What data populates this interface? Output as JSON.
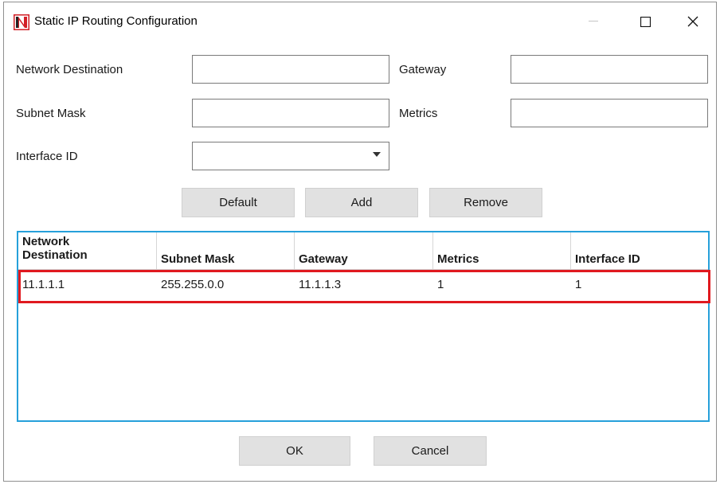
{
  "window": {
    "title": "Static IP Routing Configuration",
    "app_icon": "n-logo-icon",
    "controls": {
      "minimize": "minimize-icon",
      "maximize": "maximize-icon",
      "close": "close-icon"
    }
  },
  "form": {
    "network_destination": {
      "label": "Network Destination",
      "value": ""
    },
    "gateway": {
      "label": "Gateway",
      "value": ""
    },
    "subnet_mask": {
      "label": "Subnet Mask",
      "value": ""
    },
    "metrics": {
      "label": "Metrics",
      "value": ""
    },
    "interface_id": {
      "label": "Interface ID",
      "selected": ""
    }
  },
  "actions": {
    "default": "Default",
    "add": "Add",
    "remove": "Remove"
  },
  "table": {
    "columns": [
      "Network\nDestination",
      "Subnet Mask",
      "Gateway",
      "Metrics",
      "Interface ID"
    ],
    "rows": [
      [
        "11.1.1.1",
        "255.255.0.0",
        "11.1.1.3",
        "1",
        "1"
      ]
    ]
  },
  "footer": {
    "ok": "OK",
    "cancel": "Cancel"
  },
  "colors": {
    "grid_border": "#26a0da",
    "highlight": "#e0191f",
    "button_bg": "#e1e1e1"
  }
}
